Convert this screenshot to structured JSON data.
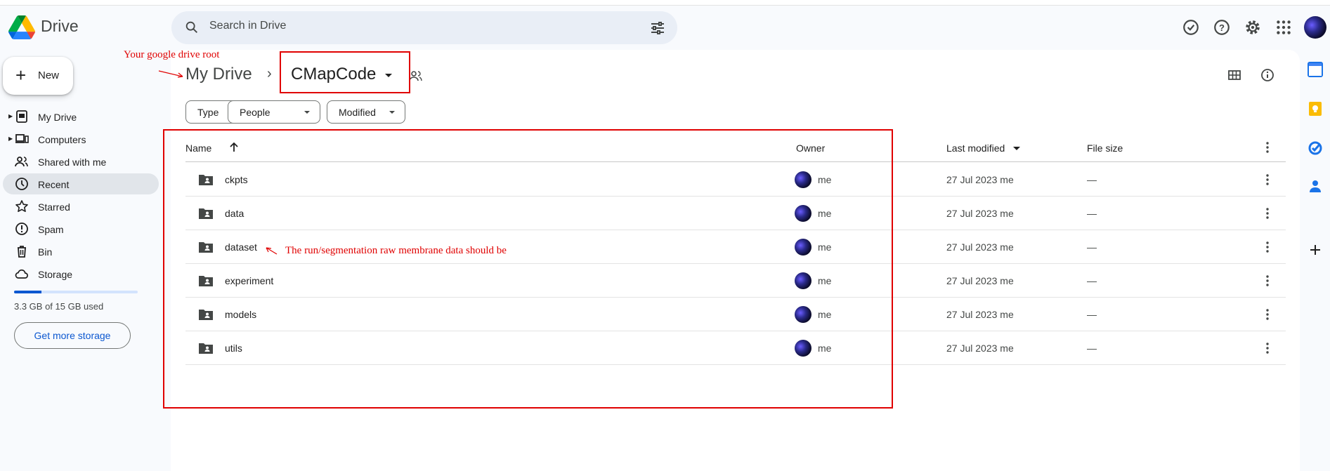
{
  "app": {
    "name": "Drive"
  },
  "search": {
    "placeholder": "Search in Drive"
  },
  "new_button": {
    "label": "New"
  },
  "sidebar": {
    "items": [
      {
        "label": "My Drive",
        "icon": "my-drive-icon"
      },
      {
        "label": "Computers",
        "icon": "computer-icon"
      },
      {
        "label": "Shared with me",
        "icon": "people-icon"
      },
      {
        "label": "Recent",
        "icon": "clock-icon",
        "active": true
      },
      {
        "label": "Starred",
        "icon": "star-icon"
      },
      {
        "label": "Spam",
        "icon": "spam-icon"
      },
      {
        "label": "Bin",
        "icon": "trash-icon"
      },
      {
        "label": "Storage",
        "icon": "cloud-icon"
      }
    ],
    "storage_used_fraction": 0.22,
    "storage_text": "3.3 GB of 15 GB used",
    "more_storage_label": "Get more storage"
  },
  "breadcrumb": {
    "root": "My Drive",
    "separator": "›",
    "current": "CMapCode"
  },
  "filters": [
    {
      "label": "Type"
    },
    {
      "label": "People"
    },
    {
      "label": "Modified"
    }
  ],
  "table": {
    "columns": {
      "name": "Name",
      "owner": "Owner",
      "last_modified": "Last modified",
      "file_size": "File size"
    },
    "rows": [
      {
        "name": "ckpts",
        "owner": "me",
        "modified": "27 Jul 2023 me",
        "size": "—"
      },
      {
        "name": "data",
        "owner": "me",
        "modified": "27 Jul 2023 me",
        "size": "—"
      },
      {
        "name": "dataset",
        "owner": "me",
        "modified": "27 Jul 2023 me",
        "size": "—"
      },
      {
        "name": "experiment",
        "owner": "me",
        "modified": "27 Jul 2023 me",
        "size": "—"
      },
      {
        "name": "models",
        "owner": "me",
        "modified": "27 Jul 2023 me",
        "size": "—"
      },
      {
        "name": "utils",
        "owner": "me",
        "modified": "27 Jul 2023 me",
        "size": "—"
      }
    ]
  },
  "annotations": {
    "root_note": "Your google drive root",
    "dataset_note": "The run/segmentation raw membrane data should be"
  },
  "colors": {
    "accent": "#0b57d0",
    "annotation": "#e00000",
    "active_nav": "#e1e5ea"
  }
}
